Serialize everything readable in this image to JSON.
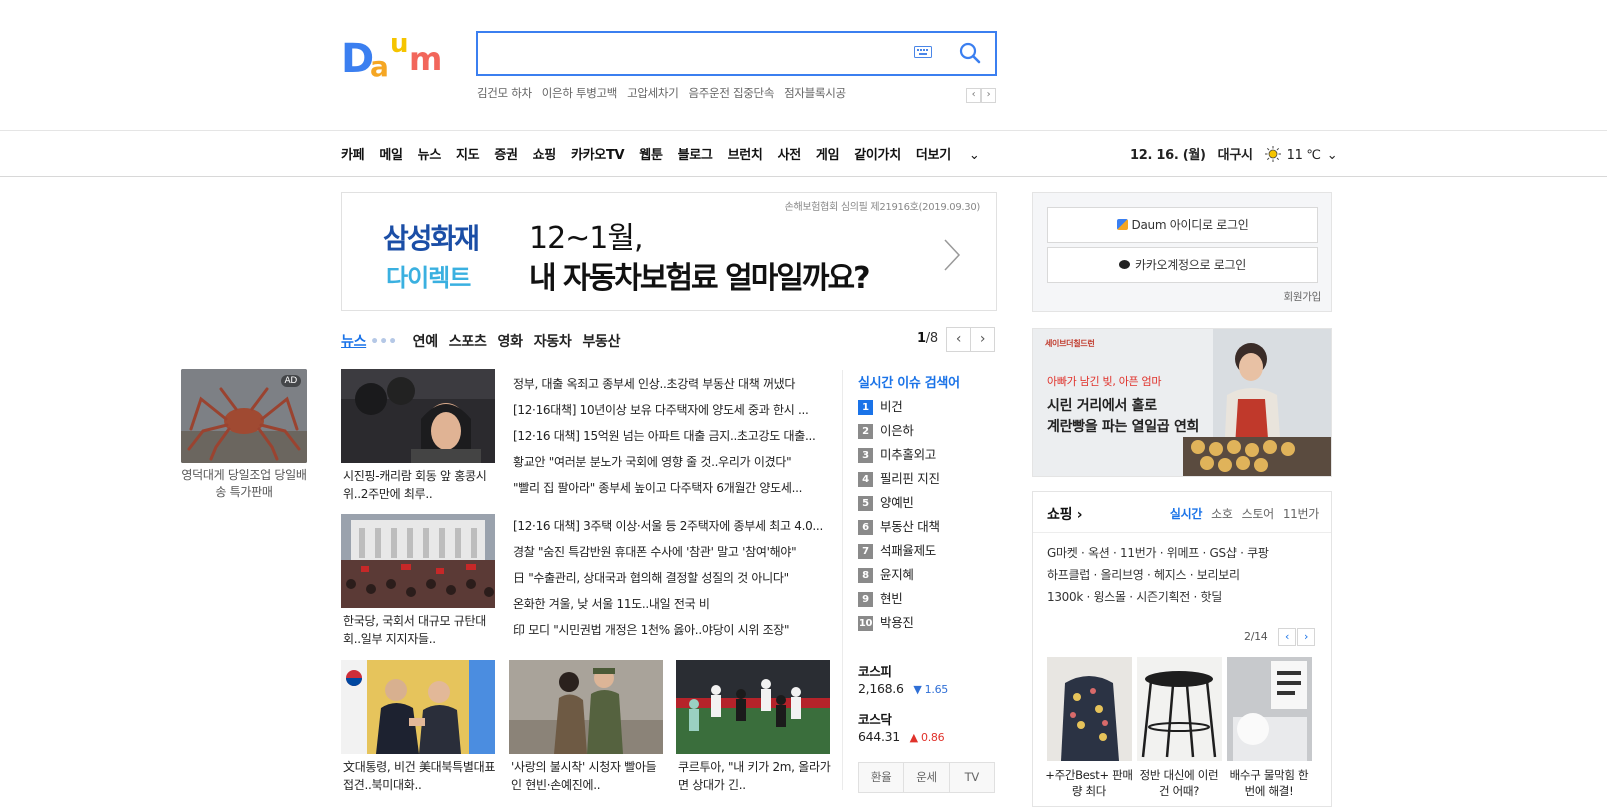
{
  "header": {
    "logo_alt": "Daum",
    "search_placeholder": "",
    "trending": [
      "김건모 하차",
      "이은하 투병고백",
      "고압세차기",
      "음주운전 집중단속",
      "점자블록시공"
    ]
  },
  "gnb": {
    "items": [
      "카페",
      "메일",
      "뉴스",
      "지도",
      "증권",
      "쇼핑",
      "카카오TV",
      "웹툰",
      "블로그",
      "브런치",
      "사전",
      "게임",
      "같이가치",
      "더보기"
    ],
    "date": "12. 16. (월)",
    "city": "대구시",
    "temperature": "11 ℃"
  },
  "ad_banner": {
    "note": "손해보험협회 심의필 제21916호(2019.09.30)",
    "brand_line1": "삼성화재",
    "brand_line2": "다이렉트",
    "headline1": "12~1월,",
    "headline2": "내 자동차보험료 얼마일까요?"
  },
  "login": {
    "daum_login": "Daum 아이디로 로그인",
    "kakao_login": "카카오계정으로 로그인",
    "join": "회원가입"
  },
  "news": {
    "tabs": [
      "뉴스",
      "연예",
      "스포츠",
      "영화",
      "자동차",
      "부동산"
    ],
    "page_current": "1",
    "page_total": "/8",
    "photo_captions": [
      "시진핑-캐리람 회동 앞 홍콩시위..2주만에 최루..",
      "한국당, 국회서 대규모 규탄대회..일부 지지자들..",
      "文대통령, 비건 美대북특별대표 접견..북미대화..",
      "'사랑의 불시착' 시청자 빨아들인 현빈·손예진에..",
      "쿠르투아, \"내 키가 2m, 올라가면 상대가 긴.."
    ],
    "headlines": [
      "정부, 대출 옥죄고 종부세 인상..초강력 부동산 대책 꺼냈다",
      "[12·16대책] 10년이상 보유 다주택자에 양도세 중과 한시 ...",
      "[12·16 대책] 15억원 넘는 아파트 대출 금지..초고강도 대출...",
      "황교안 \"여러분 분노가 국회에 영향 줄 것..우리가 이겼다\"",
      "\"빨리 집 팔아라\" 종부세 높이고 다주택자 6개월간 양도세...",
      "[12·16 대책] 3주택 이상·서울 등 2주택자에 종부세 최고 4.0...",
      "경찰 \"숨진 특감반원 휴대폰 수사에 '참관' 말고 '참여'해야\"",
      "日 \"수출관리, 상대국과 협의해 결정할 성질의 것 아니다\"",
      "온화한 겨울, 낮 서울 11도..내일 전국 비",
      "印 모디 \"시민권법 개정은 1천% 옳아..야당이 시위 조장\""
    ]
  },
  "side_ad": {
    "badge": "AD",
    "text": "영덕대게 당일조업 당일배송 특가판매"
  },
  "realtime": {
    "title": "실시간 이슈 검색어",
    "items": [
      {
        "rank": "1",
        "text": "비건"
      },
      {
        "rank": "2",
        "text": "이은하"
      },
      {
        "rank": "3",
        "text": "미추홀외고"
      },
      {
        "rank": "4",
        "text": "필리핀 지진"
      },
      {
        "rank": "5",
        "text": "양예빈"
      },
      {
        "rank": "6",
        "text": "부동산 대책"
      },
      {
        "rank": "7",
        "text": "석패율제도"
      },
      {
        "rank": "8",
        "text": "윤지혜"
      },
      {
        "rank": "9",
        "text": "현빈"
      },
      {
        "rank": "10",
        "text": "박용진"
      }
    ]
  },
  "stocks": {
    "kospi_name": "코스피",
    "kospi_value": "2,168.6",
    "kospi_change": "▼ 1.65",
    "kosdaq_name": "코스닥",
    "kosdaq_value": "644.31",
    "kosdaq_change": "▲ 0.86"
  },
  "service_tabs": [
    "환율",
    "운세",
    "TV"
  ],
  "promo": {
    "logo": "세이브더칠드런",
    "sub": "아빠가 남긴 빚, 아픈 엄마",
    "line1": "시린 거리에서 홀로",
    "line2": "계란빵을 파는 열일곱 연희"
  },
  "shopping": {
    "title": "쇼핑 ›",
    "tabs": [
      "실시간",
      "소호",
      "스토어",
      "11번가"
    ],
    "row1": "G마켓 · 옥션 · 11번가 · 위메프 · GS샵 · 쿠팡",
    "row2": "하프클럽 · 올리브영 · 헤지스 · 보리보리",
    "row3": "1300k · 윙스몰 · 시즌기획전 · 핫딜",
    "page": "2/14",
    "items": [
      "+주간Best+ 판매량 최다",
      "정반 대신에 이런건 어때?",
      "배수구 물막힘 한번에 해결!"
    ]
  },
  "colors": {
    "accent": "#1a73e8",
    "search_border": "#3b7ff0",
    "up": "#e0322b",
    "down": "#2f6fd6"
  }
}
